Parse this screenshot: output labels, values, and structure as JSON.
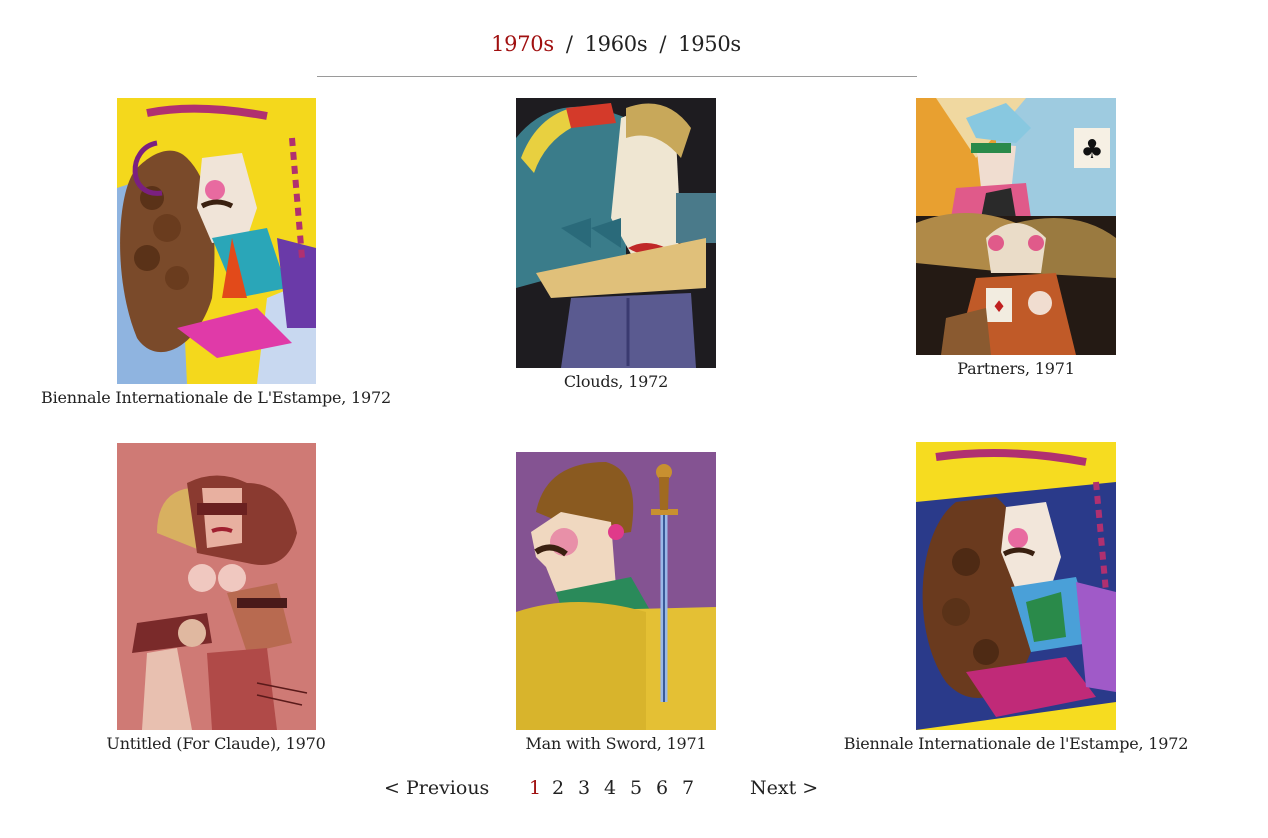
{
  "decades": [
    {
      "label": "1970s",
      "active": true
    },
    {
      "label": "1960s",
      "active": false
    },
    {
      "label": "1950s",
      "active": false
    }
  ],
  "separator": "/",
  "artworks": [
    {
      "caption": "Biennale Internationale de L'Estampe, 1972"
    },
    {
      "caption": "Clouds, 1972"
    },
    {
      "caption": "Partners, 1971"
    },
    {
      "caption": "Untitled (For Claude), 1970"
    },
    {
      "caption": "Man with Sword, 1971"
    },
    {
      "caption": "Biennale Internationale de l'Estampe, 1972"
    }
  ],
  "pagination": {
    "previous": "< Previous",
    "next": "Next >",
    "pages": [
      "1",
      "2",
      "3",
      "4",
      "5",
      "6",
      "7"
    ],
    "current_page": "1"
  },
  "colors": {
    "accent": "#a01010",
    "divider": "#9a9a9a"
  }
}
